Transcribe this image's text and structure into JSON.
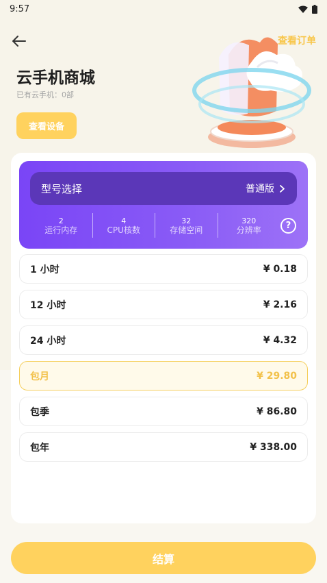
{
  "status": {
    "time": "9:57"
  },
  "header": {
    "back_icon": "arrow-left-icon",
    "orders_link": "查看订单",
    "title": "云手机商城",
    "owned": "已有云手机：0部",
    "view_device": "查看设备"
  },
  "spec_panel": {
    "model_label": "型号选择",
    "model_value": "普通版",
    "specs": [
      {
        "value": "2",
        "label": "运行内存"
      },
      {
        "value": "4",
        "label": "CPU核数"
      },
      {
        "value": "32",
        "label": "存储空间"
      },
      {
        "value": "320",
        "label": "分辨率"
      }
    ],
    "help": "?"
  },
  "plans": [
    {
      "name": "1 小时",
      "price": "¥ 0.18"
    },
    {
      "name": "12 小时",
      "price": "¥ 2.16"
    },
    {
      "name": "24 小时",
      "price": "¥ 4.32"
    },
    {
      "name": "包月",
      "price": "¥ 29.80",
      "selected": true
    },
    {
      "name": "包季",
      "price": "¥ 86.80"
    },
    {
      "name": "包年",
      "price": "¥ 338.00"
    }
  ],
  "checkout": "结算",
  "colors": {
    "accent": "#ffd25e",
    "purple": "#8050f6",
    "selected_border": "#f5cf5d"
  }
}
